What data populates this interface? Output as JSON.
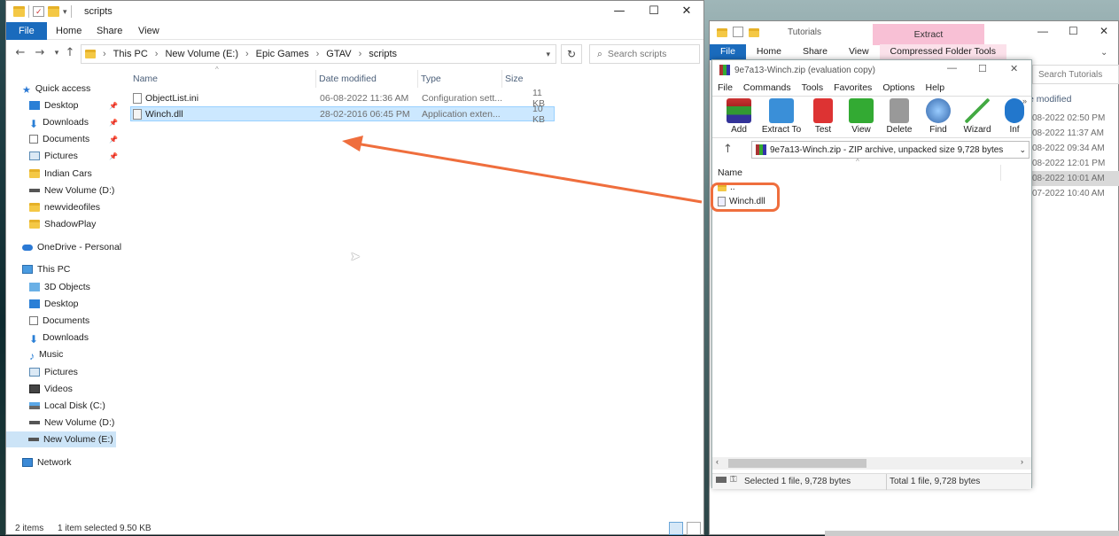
{
  "left_window": {
    "title": "scripts",
    "ribbon_tabs": [
      "File",
      "Home",
      "Share",
      "View"
    ],
    "controls": {
      "minimize": "—",
      "maximize": "☐",
      "close": "✕"
    },
    "breadcrumb": [
      "This PC",
      "New Volume (E:)",
      "Epic Games",
      "GTAV",
      "scripts"
    ],
    "search_placeholder": "Search scripts",
    "nav": {
      "quick_access": "Quick access",
      "quick_items": [
        "Desktop",
        "Downloads",
        "Documents",
        "Pictures",
        "Indian Cars",
        "New Volume (D:)",
        "newvideofiles",
        "ShadowPlay"
      ],
      "onedrive": "OneDrive - Personal",
      "this_pc": "This PC",
      "pc_items": [
        "3D Objects",
        "Desktop",
        "Documents",
        "Downloads",
        "Music",
        "Pictures",
        "Videos",
        "Local Disk (C:)",
        "New Volume (D:)",
        "New Volume (E:)"
      ],
      "network": "Network"
    },
    "columns": {
      "name": "Name",
      "date": "Date modified",
      "type": "Type",
      "size": "Size"
    },
    "files": [
      {
        "name": "ObjectList.ini",
        "date": "06-08-2022 11:36 AM",
        "type": "Configuration sett...",
        "size": "11 KB"
      },
      {
        "name": "Winch.dll",
        "date": "28-02-2016 06:45 PM",
        "type": "Application exten...",
        "size": "10 KB"
      }
    ],
    "status": {
      "items": "2 items",
      "selected": "1 item selected",
      "size": "9.50 KB"
    }
  },
  "right_window": {
    "title": "Tutorials",
    "extract_tab": "Extract",
    "ribbon_tabs": [
      "File",
      "Home",
      "Share",
      "View",
      "Compressed Folder Tools"
    ],
    "search_placeholder": "Search Tutorials",
    "col_header": "e modified",
    "dates": [
      "08-2022 02:50 PM",
      "08-2022 11:37 AM",
      "08-2022 09:34 AM",
      "08-2022 12:01 PM",
      "08-2022 10:01 AM",
      "07-2022 10:40 AM"
    ]
  },
  "winrar": {
    "title": "9e7a13-Winch.zip (evaluation copy)",
    "menu": [
      "File",
      "Commands",
      "Tools",
      "Favorites",
      "Options",
      "Help"
    ],
    "tools": [
      "Add",
      "Extract To",
      "Test",
      "View",
      "Delete",
      "Find",
      "Wizard",
      "Inf"
    ],
    "path": "9e7a13-Winch.zip - ZIP archive, unpacked size 9,728 bytes",
    "col_name": "Name",
    "items": [
      "..",
      "Winch.dll"
    ],
    "status_left": "Selected 1 file, 9,728 bytes",
    "status_right": "Total 1 file, 9,728 bytes"
  }
}
